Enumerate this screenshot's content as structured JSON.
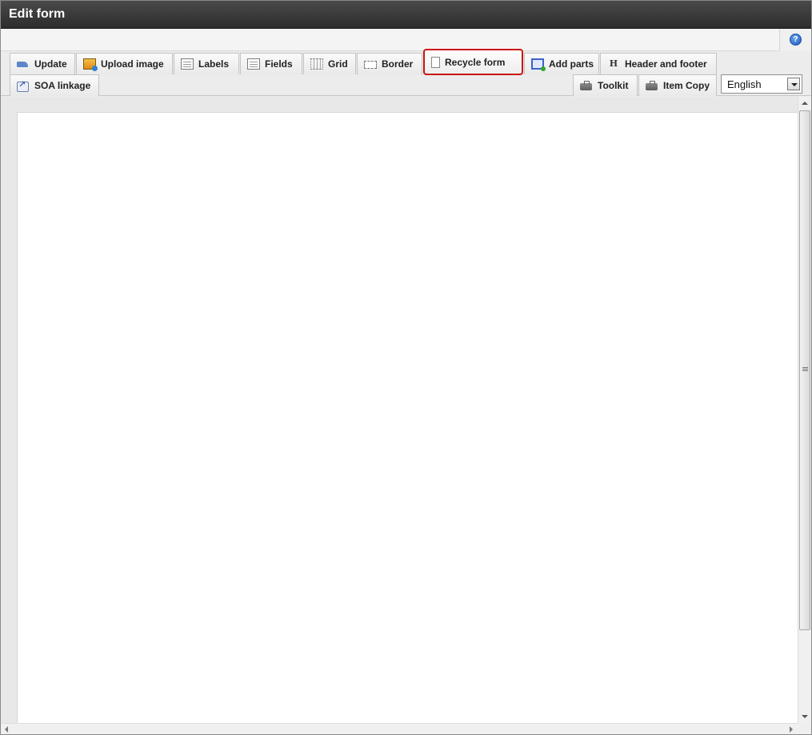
{
  "window": {
    "title": "Edit form"
  },
  "help": {
    "icon": "help-icon",
    "glyph": "?"
  },
  "toolbar": {
    "tabs": [
      {
        "label": "Update",
        "icon": "update-icon"
      },
      {
        "label": "Upload image",
        "icon": "upload-image-icon"
      },
      {
        "label": "Labels",
        "icon": "labels-icon"
      },
      {
        "label": "Fields",
        "icon": "fields-icon"
      },
      {
        "label": "Grid",
        "icon": "grid-icon"
      },
      {
        "label": "Border",
        "icon": "border-icon"
      },
      {
        "label": "Recycle form",
        "icon": "recycle-form-icon",
        "highlighted": true
      },
      {
        "label": "Add parts",
        "icon": "add-parts-icon"
      },
      {
        "label": "Header and footer",
        "icon": "header-footer-icon",
        "glyph": "H"
      },
      {
        "label": "SOA linkage",
        "icon": "soa-linkage-icon"
      },
      {
        "label": "Toolkit",
        "icon": "toolkit-icon"
      },
      {
        "label": "Item Copy",
        "icon": "item-copy-icon"
      }
    ],
    "language": {
      "selected": "English"
    }
  },
  "colors": {
    "highlight": "#cc1111",
    "titlebar": "#2c2c2c"
  }
}
